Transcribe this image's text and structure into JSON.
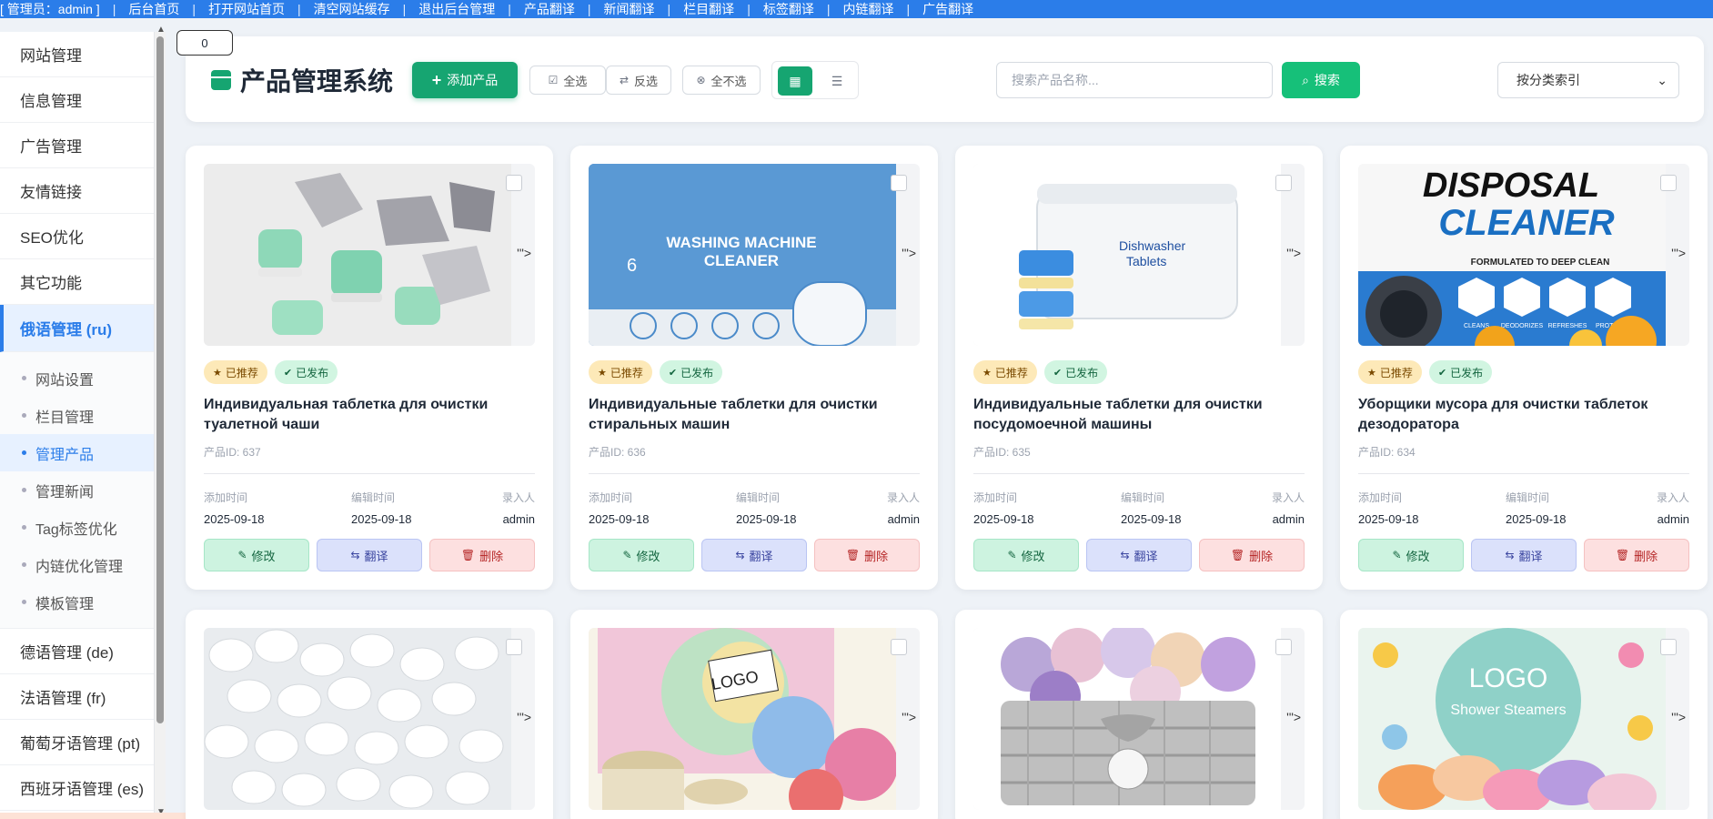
{
  "topbar": {
    "admin_label": "[ 管理员：admin ]",
    "links": [
      "后台首页",
      "打开网站首页",
      "清空网站缓存",
      "退出后台管理",
      "产品翻译",
      "新闻翻译",
      "栏目翻译",
      "标签翻译",
      "内链翻译",
      "广告翻译"
    ]
  },
  "sidebar": {
    "items_top": [
      "网站管理",
      "信息管理",
      "广告管理",
      "友情链接",
      "SEO优化",
      "其它功能"
    ],
    "active_item": "俄语管理 (ru)",
    "sub_items": [
      "网站设置",
      "栏目管理",
      "管理产品",
      "管理新闻",
      "Tag标签优化",
      "内链优化管理",
      "模板管理"
    ],
    "items_bottom": [
      "德语管理 (de)",
      "法语管理 (fr)",
      "葡萄牙语管理 (pt)",
      "西班牙语管理 (es)"
    ]
  },
  "header": {
    "counter": "0",
    "title": "产品管理系统",
    "add_label": "添加产品",
    "select_all": "全选",
    "invert": "反选",
    "select_none": "全不选",
    "search_placeholder": "搜索产品名称...",
    "search_label": "搜索",
    "category_select": "按分类索引"
  },
  "labels": {
    "recommended": "已推荐",
    "published": "已发布",
    "added": "添加时间",
    "edited": "编辑时间",
    "author": "录入人",
    "edit": "修改",
    "translate": "翻译",
    "delete": "删除",
    "artifact": "'\">"
  },
  "products": [
    {
      "name": "Индивидуальная таблетка для очистки туалетной чаши",
      "id_label": "产品ID: 637",
      "added": "2025-09-18",
      "edited": "2025-09-18",
      "author": "admin"
    },
    {
      "name": "Индивидуальные таблетки для очистки стиральных машин",
      "id_label": "产品ID: 636",
      "added": "2025-09-18",
      "edited": "2025-09-18",
      "author": "admin",
      "img_text_1": "WASHING MACHINE",
      "img_text_2": "CLEANER",
      "img_text_3": "6"
    },
    {
      "name": "Индивидуальные таблетки для очистки посудомоечной машины",
      "id_label": "产品ID: 635",
      "added": "2025-09-18",
      "edited": "2025-09-18",
      "author": "admin",
      "img_text_1": "Dishwasher",
      "img_text_2": "Tablets"
    },
    {
      "name": "Уборщики мусора для очистки таблеток дезодоратора",
      "id_label": "产品ID: 634",
      "added": "2025-09-18",
      "edited": "2025-09-18",
      "author": "admin",
      "img_text_1": "DISPOSAL",
      "img_text_2": "CLEANER",
      "img_text_3": "FORMULATED TO DEEP CLEAN",
      "img_badges": [
        "CLEANS",
        "DEODORIZES",
        "REFRESHES",
        "PROTECTS"
      ]
    },
    {
      "name": "",
      "id_label": ""
    },
    {
      "name": "",
      "id_label": "",
      "img_text_1": "LOGO"
    },
    {
      "name": "",
      "id_label": ""
    },
    {
      "name": "",
      "id_label": "",
      "img_text_1": "LOGO",
      "img_text_2": "Shower Steamers"
    }
  ]
}
